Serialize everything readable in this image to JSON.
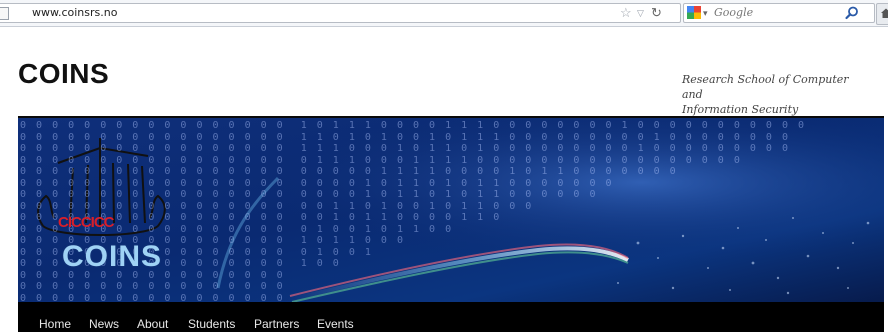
{
  "browser": {
    "url_host": "www.coinsrs.no",
    "search_placeholder": "Google",
    "icons": {
      "star": "bookmark-star-icon",
      "dropdown": "chevron-down-icon",
      "reload": "reload-icon",
      "search": "search-icon",
      "home": "home-icon",
      "engine": "google-icon"
    }
  },
  "header": {
    "title": "COINS",
    "tagline_line1": "Research School of Computer and",
    "tagline_line2": "Information Security"
  },
  "banner": {
    "logo_text": "COINS",
    "logo_sail_text": "CICCICC"
  },
  "nav": {
    "items": [
      {
        "label": "Home"
      },
      {
        "label": "News"
      },
      {
        "label": "About"
      },
      {
        "label": "Students"
      },
      {
        "label": "Partners"
      },
      {
        "label": "Events"
      }
    ]
  },
  "colors": {
    "banner_bg": "#0b2a6e",
    "nav_bg": "#000000",
    "logo_text": "#9fd2f5",
    "logo_sail": "#d81f2a"
  }
}
